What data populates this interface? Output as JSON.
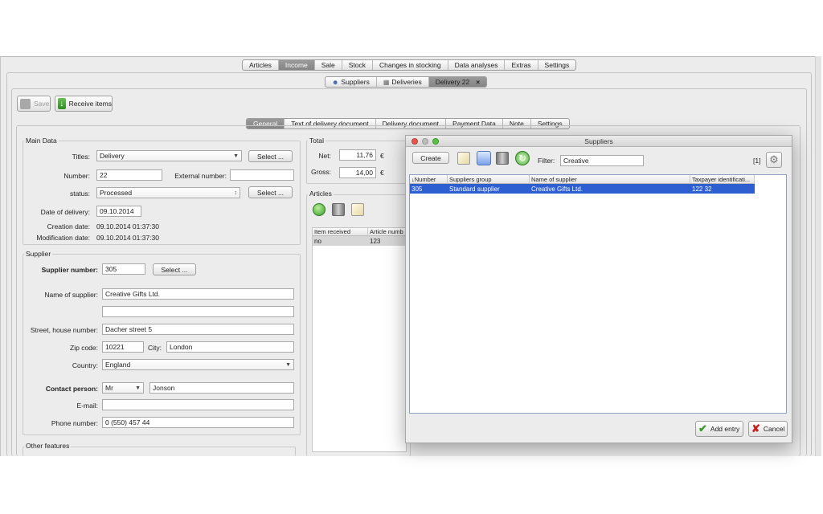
{
  "main_tabs": [
    {
      "label": "Articles",
      "selected": false
    },
    {
      "label": "Income",
      "selected": true
    },
    {
      "label": "Sale",
      "selected": false
    },
    {
      "label": "Stock",
      "selected": false
    },
    {
      "label": "Changes in stocking",
      "selected": false
    },
    {
      "label": "Data analyses",
      "selected": false
    },
    {
      "label": "Extras",
      "selected": false
    },
    {
      "label": "Settings",
      "selected": false
    }
  ],
  "sub_tabs": [
    {
      "label": "Suppliers",
      "icon": "suppliers-icon"
    },
    {
      "label": "Deliveries",
      "icon": "deliveries-icon"
    },
    {
      "label": "Delivery 22",
      "close": "×"
    }
  ],
  "toolbar": {
    "save_label": "Save",
    "receive_label": "Receive items"
  },
  "doc_tabs": [
    {
      "label": "General",
      "selected": true
    },
    {
      "label": "Text of delivery document",
      "selected": false
    },
    {
      "label": "Delivery document",
      "selected": false
    },
    {
      "label": "Payment Data",
      "selected": false
    },
    {
      "label": "Note",
      "selected": false
    },
    {
      "label": "Settings",
      "selected": false
    }
  ],
  "main_data": {
    "title": "Main Data",
    "titles_label": "Titles:",
    "titles_value": "Delivery",
    "select_label": "Select ...",
    "number_label": "Number:",
    "number_value": "22",
    "external_label": "External number:",
    "external_value": "",
    "status_label": "status:",
    "status_value": "Processed",
    "delivery_date_label": "Date of delivery:",
    "delivery_date_value": "09.10.2014",
    "creation_label": "Creation date:",
    "creation_value": "09.10.2014  01:37:30",
    "modification_label": "Modification date:",
    "modification_value": "09.10.2014  01:37:30"
  },
  "total": {
    "title": "Total",
    "net_label": "Net:",
    "net_value": "11,76",
    "net_currency": "€",
    "gross_label": "Gross:",
    "gross_value": "14,00",
    "gross_currency": "€"
  },
  "articles": {
    "title": "Articles",
    "columns": [
      "Item received",
      "Article numb"
    ],
    "rows": [
      [
        "no",
        "123"
      ]
    ]
  },
  "supplier": {
    "title": "Supplier",
    "number_label": "Supplier number:",
    "number_value": "305",
    "select_label": "Select ...",
    "name_label": "Name of supplier:",
    "name_value": "Creative Gifts Ltd.",
    "name2_value": "",
    "street_label": "Street, house number:",
    "street_value": "Dacher street 5",
    "zip_label": "Zip code:",
    "zip_value": "10221",
    "city_label": "City:",
    "city_value": "London",
    "country_label": "Country:",
    "country_value": "England",
    "contact_label": "Contact person:",
    "salutation_value": "Mr",
    "contact_value": "Jonson",
    "email_label": "E-mail:",
    "email_value": "",
    "phone_label": "Phone number:",
    "phone_value": "0 (550) 457 44"
  },
  "other_features_title": "Other features",
  "dialog": {
    "title": "Suppliers",
    "create_label": "Create",
    "filter_label": "Filter:",
    "filter_value": "Creative",
    "count": "[1]",
    "columns": [
      "↓Number",
      "Suppliers group",
      "Name of supplier",
      "Taxpayer identificati..."
    ],
    "rows": [
      [
        "305",
        "Standard supplier",
        "Creative Gifts Ltd.",
        "122 32"
      ]
    ],
    "add_label": "Add entry",
    "cancel_label": "Cancel"
  },
  "colors": {
    "selection": "#2d5fd0",
    "accent_green": "#3a9a2a",
    "cancel_red": "#c82020"
  }
}
